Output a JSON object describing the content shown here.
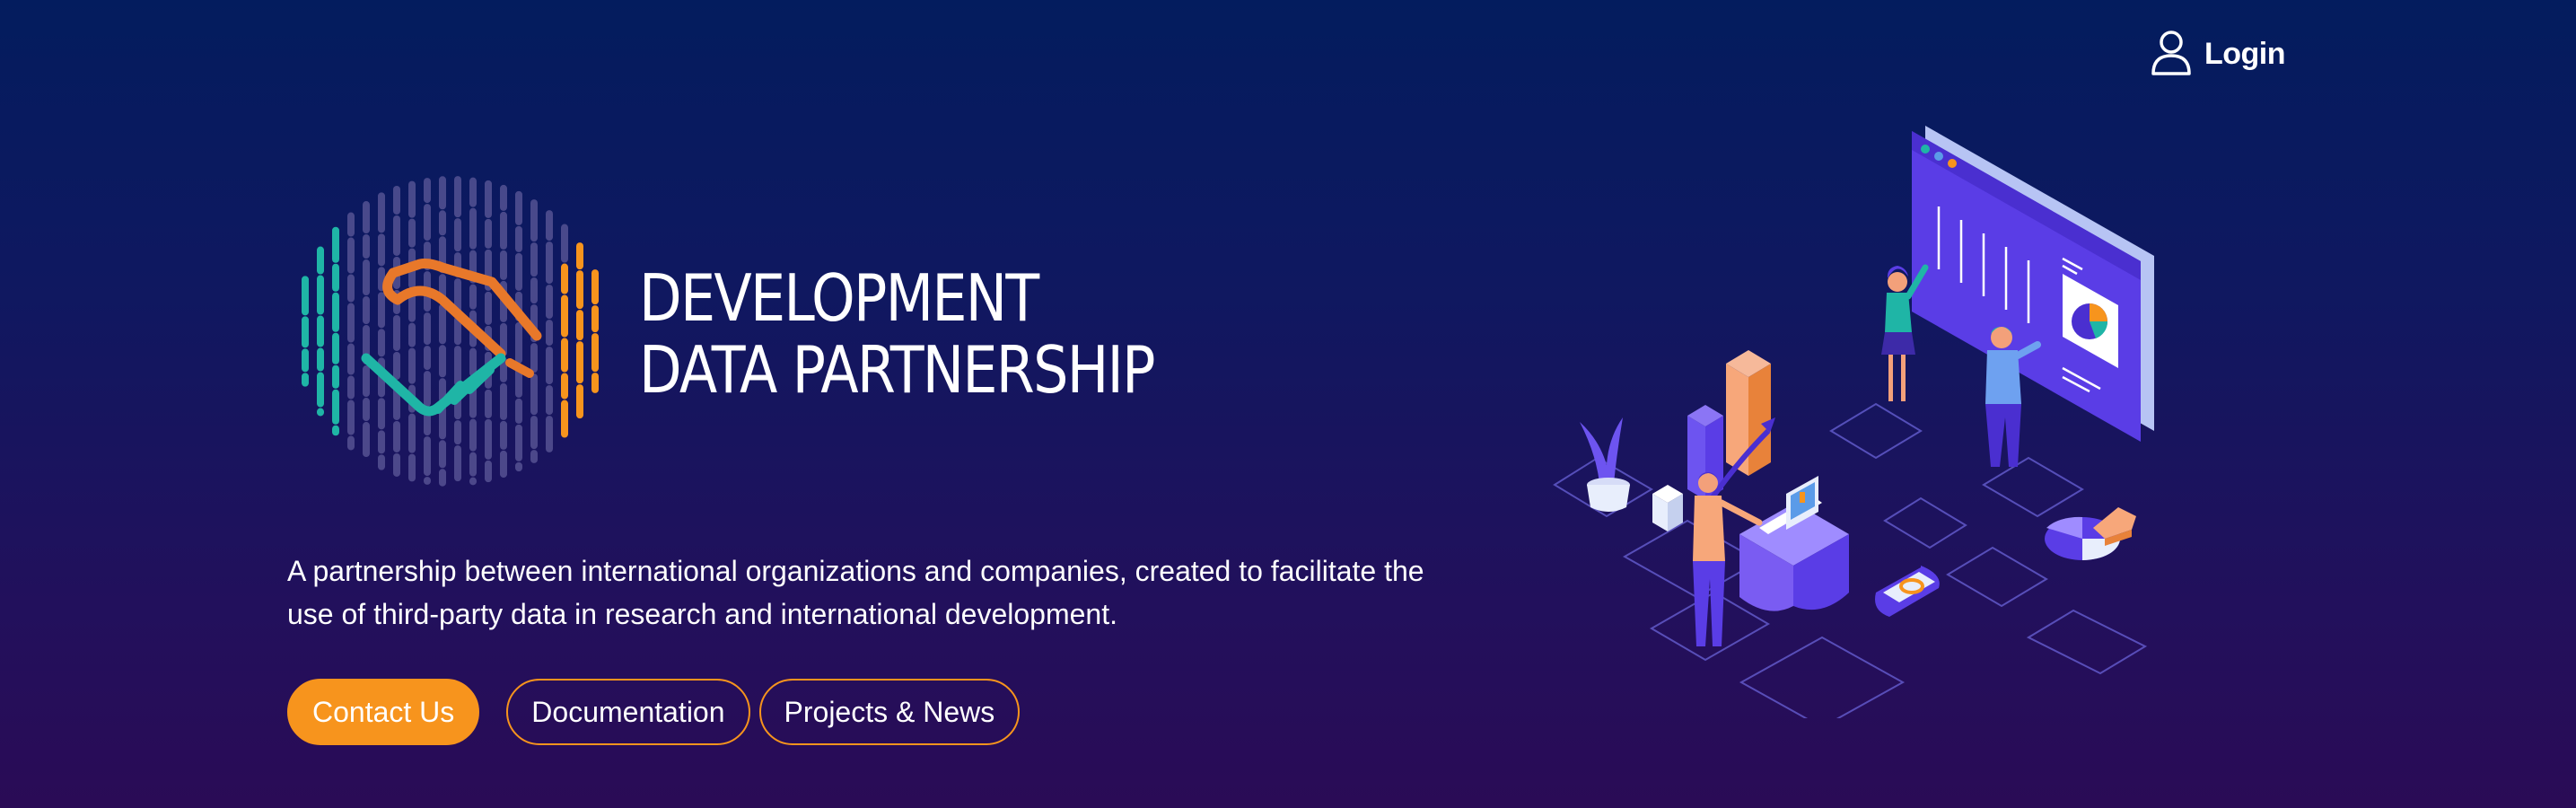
{
  "header": {
    "login_label": "Login",
    "login_icon": "user-icon"
  },
  "logo": {
    "icon": "handshake-icon",
    "title_line1": "DEVELOPMENT",
    "title_line2": "DATA PARTNERSHIP"
  },
  "hero": {
    "tagline": "A partnership between international organizations and companies, created to facilitate the use of third-party data in research and international development.",
    "buttons": {
      "contact": "Contact Us",
      "documentation": "Documentation",
      "projects": "Projects & News"
    }
  },
  "colors": {
    "accent": "#f7941d",
    "teal": "#1fb5a6",
    "background_top": "#031c5e",
    "background_bottom": "#2a0b56"
  }
}
